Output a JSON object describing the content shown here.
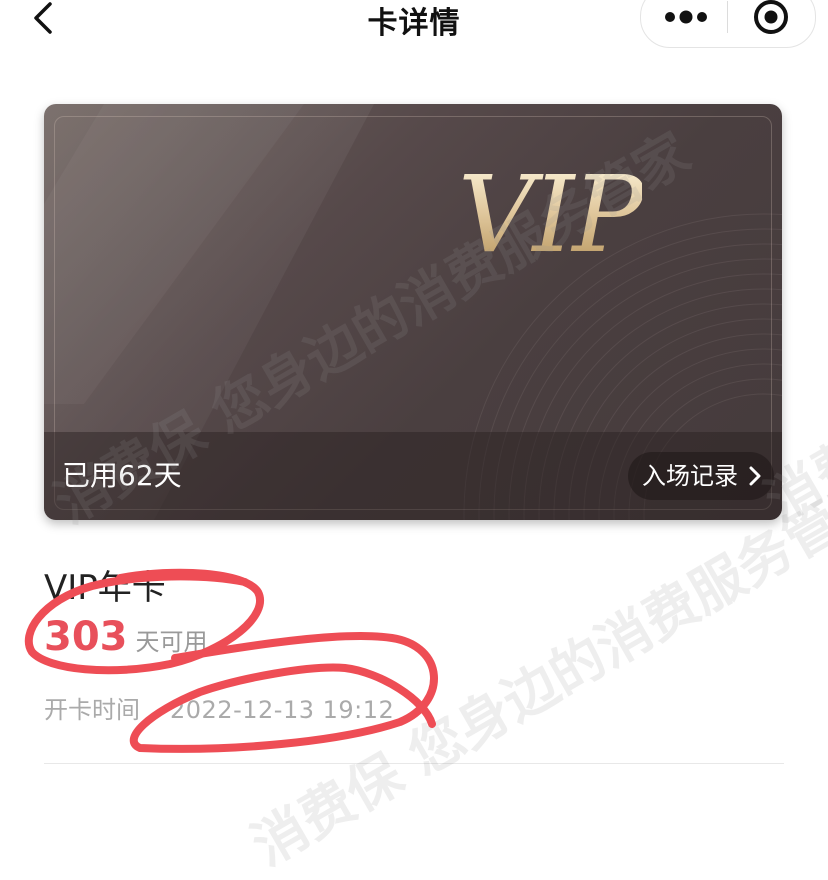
{
  "navbar": {
    "title": "卡详情",
    "back_icon": "chevron-left-icon",
    "more_icon": "more-dots-icon",
    "close_icon": "target-circle-icon"
  },
  "card": {
    "logo_text": "VIP",
    "used_label": "已用62天",
    "entry_label": "入场记录",
    "entry_icon": "chevron-right-icon"
  },
  "details": {
    "name": "VIP年卡",
    "remaining_number": "303",
    "remaining_unit": "天可用",
    "open_time_label": "开卡时间",
    "open_time_value": "2022-12-13 19:12"
  },
  "watermark": {
    "text_long": "消费保 您身边的消费服务管家",
    "text_short": "消费保"
  },
  "colors": {
    "accent_red": "#e8505b",
    "card_bg": "#4a3f40",
    "gold": "#e2caa0",
    "scribble_red": "#ee4d55"
  }
}
